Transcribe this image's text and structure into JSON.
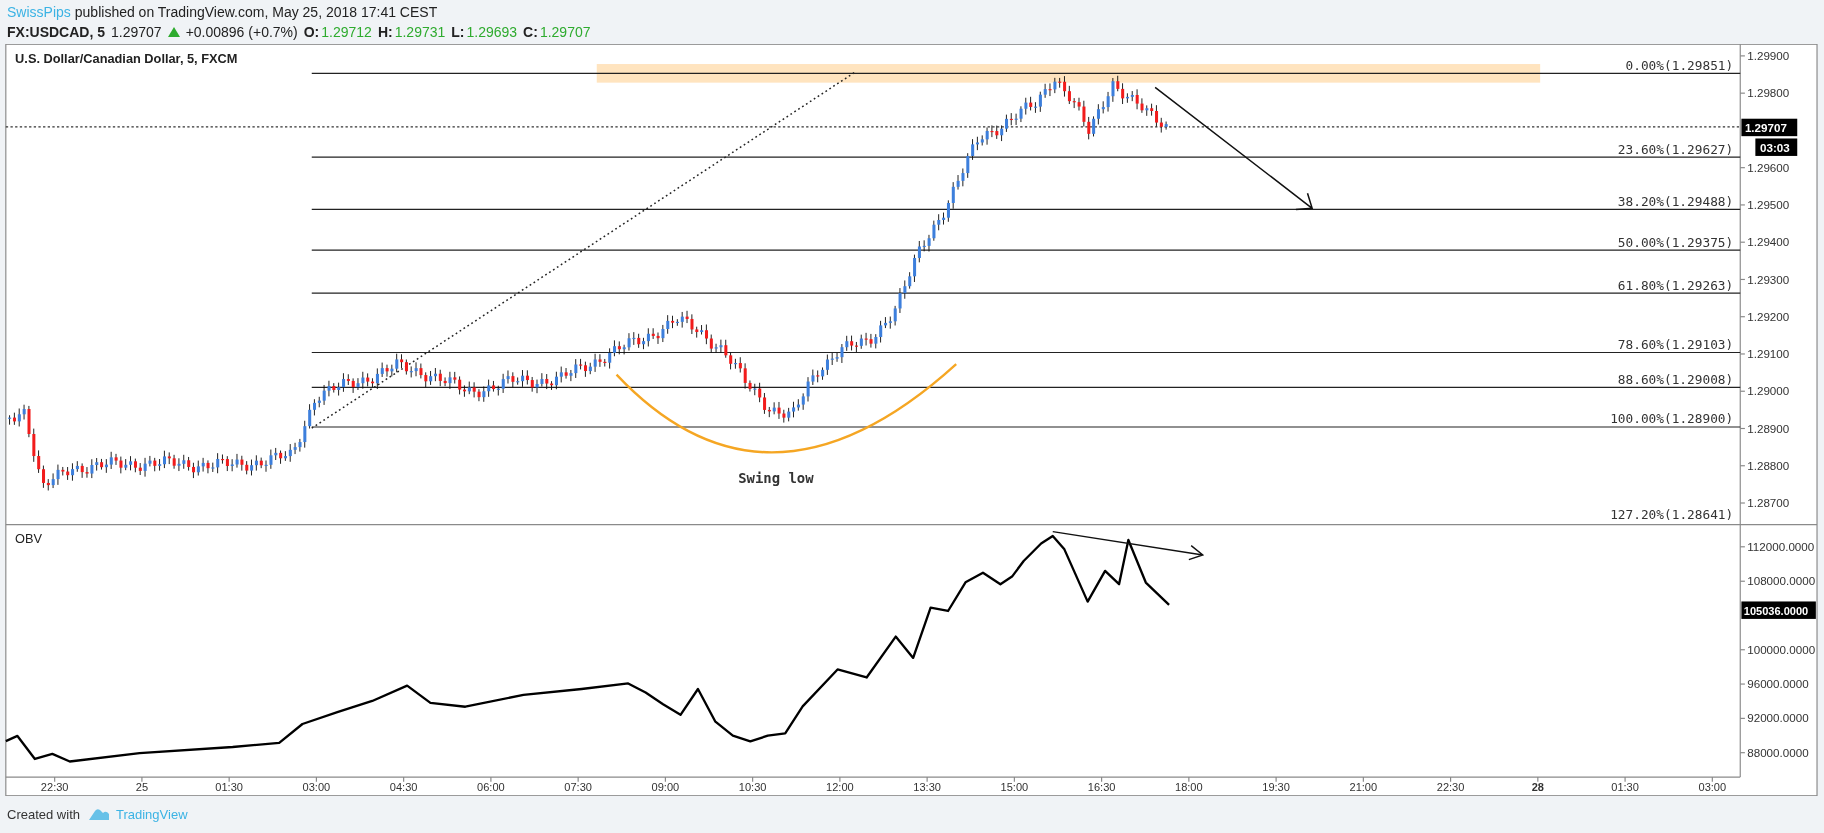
{
  "header": {
    "author": "SwissPips",
    "published": "published on TradingView.com, May 25, 2018 17:41 CEST"
  },
  "quote": {
    "symbol": "FX:USDCAD, 5",
    "last": "1.29707",
    "rising": true,
    "change": "+0.00896 (+0.7%)",
    "ohlc": [
      {
        "label": "O:",
        "value": "1.29712"
      },
      {
        "label": "H:",
        "value": "1.29731"
      },
      {
        "label": "L:",
        "value": "1.29693"
      },
      {
        "label": "C:",
        "value": "1.29707"
      }
    ]
  },
  "main_pane": {
    "title": "U.S. Dollar/Canadian Dollar, 5, FXCM",
    "price_axis": [
      "1.29900",
      "1.29800",
      "1.29600",
      "1.29500",
      "1.29400",
      "1.29300",
      "1.29200",
      "1.29100",
      "1.29000",
      "1.28900",
      "1.28800",
      "1.28700"
    ],
    "last_price": "1.29707",
    "countdown": "03:03",
    "fib_levels": [
      {
        "label": "0.00%(1.29851)"
      },
      {
        "label": "23.60%(1.29627)"
      },
      {
        "label": "38.20%(1.29488)"
      },
      {
        "label": "50.00%(1.29375)"
      },
      {
        "label": "61.80%(1.29263)"
      },
      {
        "label": "78.60%(1.29103)"
      },
      {
        "label": "88.60%(1.29008)"
      },
      {
        "label": "100.00%(1.28900)"
      },
      {
        "label": "127.20%(1.28641)"
      }
    ],
    "annotation": "Swing low"
  },
  "obv_pane": {
    "title": "OBV",
    "axis": [
      "112000.0000",
      "108000.0000",
      "100000.0000",
      "96000.0000",
      "92000.0000",
      "88000.0000"
    ],
    "last_value": "105036.0000"
  },
  "time_axis": [
    {
      "label": "22:30",
      "bold": false
    },
    {
      "label": "25",
      "bold": false
    },
    {
      "label": "01:30",
      "bold": false
    },
    {
      "label": "03:00",
      "bold": false
    },
    {
      "label": "04:30",
      "bold": false
    },
    {
      "label": "06:00",
      "bold": false
    },
    {
      "label": "07:30",
      "bold": false
    },
    {
      "label": "09:00",
      "bold": false
    },
    {
      "label": "10:30",
      "bold": false
    },
    {
      "label": "12:00",
      "bold": false
    },
    {
      "label": "13:30",
      "bold": false
    },
    {
      "label": "15:00",
      "bold": false
    },
    {
      "label": "16:30",
      "bold": false
    },
    {
      "label": "18:00",
      "bold": false
    },
    {
      "label": "19:30",
      "bold": false
    },
    {
      "label": "21:00",
      "bold": false
    },
    {
      "label": "22:30",
      "bold": false
    },
    {
      "label": "28",
      "bold": true
    },
    {
      "label": "01:30",
      "bold": false
    },
    {
      "label": "03:00",
      "bold": false
    }
  ],
  "footer": {
    "text": "Created with",
    "brand": "TradingView"
  }
}
